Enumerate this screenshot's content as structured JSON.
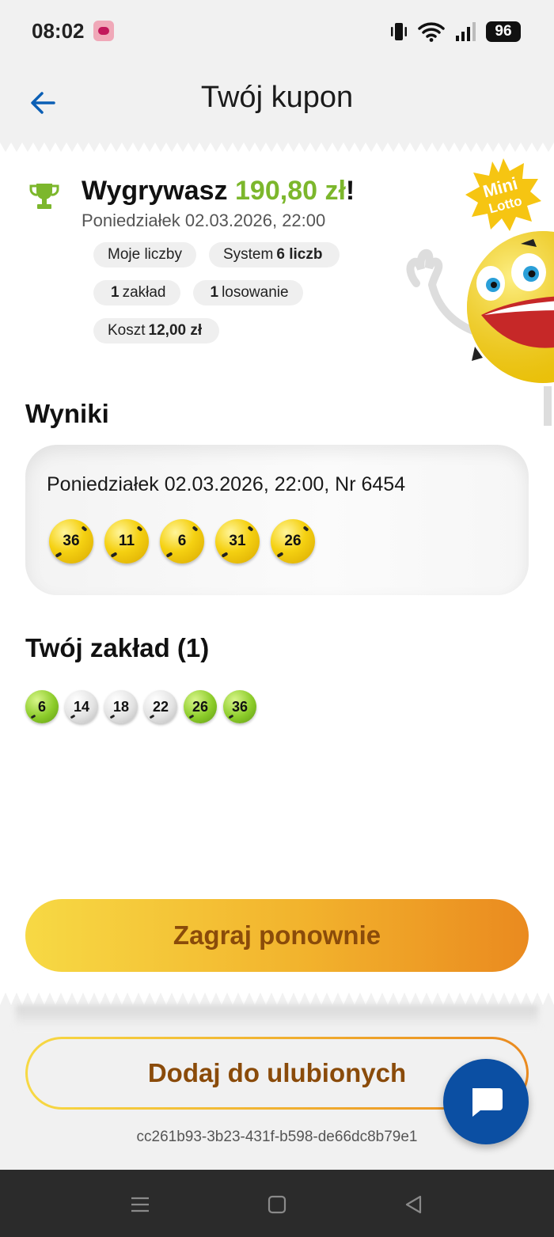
{
  "status_bar": {
    "time": "08:02",
    "battery": "96",
    "icons": [
      "app-notification-icon",
      "vibrate-icon",
      "wifi-icon",
      "signal-icon",
      "battery-icon"
    ]
  },
  "header": {
    "title": "Twój kupon",
    "back_icon": "arrow-left-icon"
  },
  "summary": {
    "win_prefix": "Wygrywasz ",
    "win_amount": "190,80 zł",
    "win_suffix": "!",
    "date": "Poniedziałek 02.03.2026, 22:00",
    "chips": {
      "my_numbers": "Moje liczby",
      "system_prefix": "System",
      "system_value": "6 liczb",
      "bets_value": "1",
      "bets_label": "zakład",
      "draws_value": "1",
      "draws_label": "losowanie",
      "cost_label": "Koszt",
      "cost_value": "12,00 zł"
    },
    "game_logo_line1": "Mini",
    "game_logo_line2": "Lotto"
  },
  "results": {
    "title": "Wyniki",
    "draw_text": "Poniedziałek 02.03.2026, 22:00, Nr 6454",
    "balls": [
      "36",
      "11",
      "6",
      "31",
      "26"
    ]
  },
  "your_bet": {
    "title": "Twój zakład (1)",
    "balls": [
      {
        "n": "6",
        "hit": true
      },
      {
        "n": "14",
        "hit": false
      },
      {
        "n": "18",
        "hit": false
      },
      {
        "n": "22",
        "hit": false
      },
      {
        "n": "26",
        "hit": true
      },
      {
        "n": "36",
        "hit": true
      }
    ]
  },
  "actions": {
    "play_again": "Zagraj ponownie",
    "add_favorite": "Dodaj do ulubionych"
  },
  "coupon_id": "cc261b93-3b23-431f-b598-de66dc8b79e1",
  "colors": {
    "accent_green": "#7cb72c",
    "brand_blue": "#0b4fa3",
    "gradient_start": "#f7d944",
    "gradient_end": "#ea8a1f",
    "button_text": "#8a4b0a"
  }
}
